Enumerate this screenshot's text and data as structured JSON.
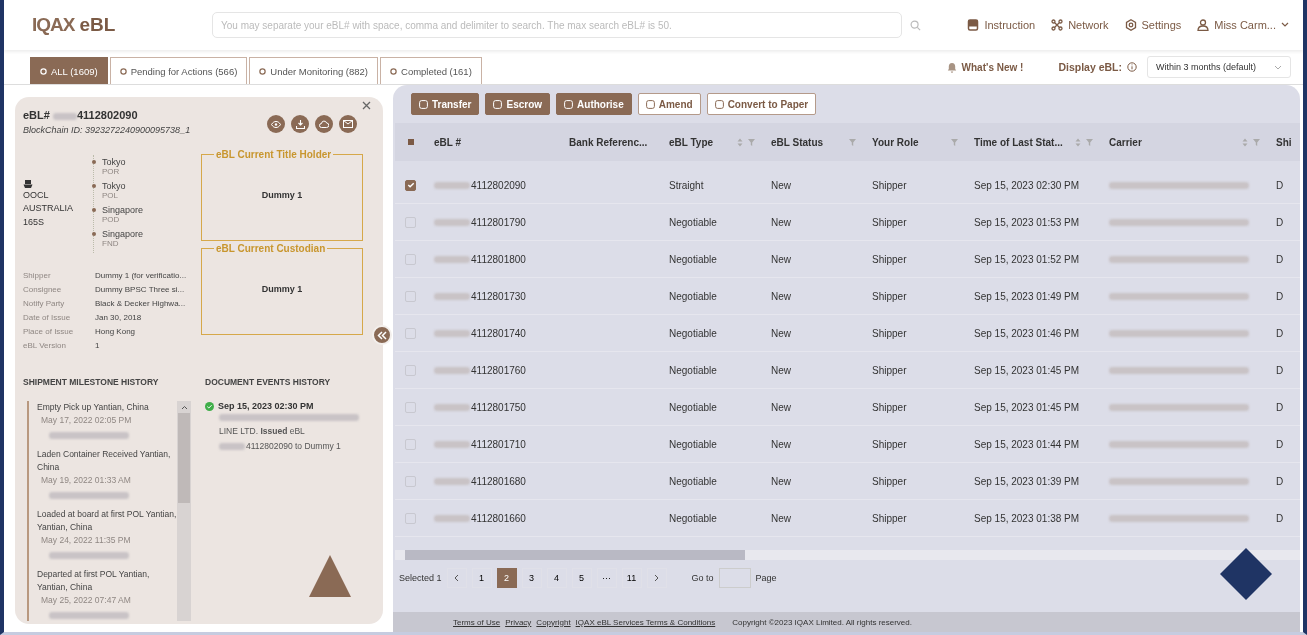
{
  "header": {
    "logo": "IQAX",
    "product": "eBL",
    "search": {
      "placeholder": "You may separate your eBL# with space, comma and delimiter to search. The max search eBL# is 50."
    },
    "nav": [
      {
        "kind": "book",
        "label": "Instruction"
      },
      {
        "kind": "network",
        "label": "Network"
      },
      {
        "kind": "gear",
        "label": "Settings"
      },
      {
        "kind": "user",
        "label": "Miss Carm..."
      }
    ]
  },
  "tabs": [
    {
      "label": "ALL (1609)",
      "selected": true
    },
    {
      "label": "Pending for Actions (566)",
      "selected": false
    },
    {
      "label": "Under Monitoring (882)",
      "selected": false
    },
    {
      "label": "Completed (161)",
      "selected": false
    }
  ],
  "whats_new": "What's New !",
  "display": {
    "label": "Display eBL:",
    "value": "Within 3 months (default)"
  },
  "detail": {
    "ebl_prefix": "eBL#",
    "ebl_no": "4112802090",
    "blockchain_id": "BlockChain ID: 3923272240900095738_1",
    "vessel": "OOCL AUSTRALIA 165S",
    "route": [
      {
        "place": "Tokyo",
        "code": "POR"
      },
      {
        "place": "Tokyo",
        "code": "POL"
      },
      {
        "place": "Singapore",
        "code": "POD"
      },
      {
        "place": "Singapore",
        "code": "FND"
      }
    ],
    "title_holder": {
      "legend": "eBL Current Title Holder",
      "value": "Dummy 1"
    },
    "custodian": {
      "legend": "eBL Current Custodian",
      "value": "Dummy 1"
    },
    "fields": [
      {
        "label": "Shipper",
        "value": "Dummy 1 (for verificatio..."
      },
      {
        "label": "Consignee",
        "value": "Dummy BPSC Three si..."
      },
      {
        "label": "Notify Party",
        "value": "Black & Decker Highwa..."
      },
      {
        "label": "Date of Issue",
        "value": "Jan 30, 2018"
      },
      {
        "label": "Place of Issue",
        "value": "Hong Kong"
      },
      {
        "label": "eBL Version",
        "value": "1"
      }
    ],
    "milestone_heading": "SHIPMENT MILESTONE HISTORY",
    "milestones": [
      {
        "event": "Empty Pick up Yantian, China",
        "date": "May 17, 2022 02:05 PM"
      },
      {
        "event": "Laden Container Received Yantian, China",
        "date": "May 19, 2022 01:33 AM"
      },
      {
        "event": "Loaded at board at first POL Yantian, Yantian, China",
        "date": "May 24, 2022 11:35 PM"
      },
      {
        "event": "Departed at first POL Yantian, Yantian, China",
        "date": "May 25, 2022 07:47 AM"
      }
    ],
    "events_heading": "DOCUMENT EVENTS HISTORY",
    "events": [
      {
        "time": "Sep 15, 2023 02:30 PM",
        "done": true,
        "text": "LINE LTD. **Issued** eBL",
        "target": "4112802090 to Dummy 1"
      }
    ]
  },
  "toolbar": [
    {
      "label": "Transfer",
      "kind": "primary"
    },
    {
      "label": "Escrow",
      "kind": "primary"
    },
    {
      "label": "Authorise",
      "kind": "primary"
    },
    {
      "label": "Amend",
      "kind": "outline"
    },
    {
      "label": "Convert to Paper",
      "kind": "outline"
    }
  ],
  "table": {
    "select_all_indeterminate": true,
    "columns": [
      {
        "label": "eBL #",
        "sort": false,
        "filter": false
      },
      {
        "label": "Bank Referenc...",
        "sort": false,
        "filter": false
      },
      {
        "label": "eBL Type",
        "sort": true,
        "filter": true
      },
      {
        "label": "eBL Status",
        "sort": false,
        "filter": true
      },
      {
        "label": "Your Role",
        "sort": false,
        "filter": true
      },
      {
        "label": "Time of Last Stat...",
        "sort": true,
        "filter": true
      },
      {
        "label": "Carrier",
        "sort": true,
        "filter": true
      },
      {
        "label": "Shi"
      }
    ],
    "rows": [
      {
        "selected": true,
        "ebl": "4112802090",
        "type": "Straight",
        "status": "New",
        "role": "Shipper",
        "time": "Sep 15, 2023 02:30 PM",
        "ship": "D"
      },
      {
        "selected": false,
        "ebl": "4112801790",
        "type": "Negotiable",
        "status": "New",
        "role": "Shipper",
        "time": "Sep 15, 2023 01:53 PM",
        "ship": "D"
      },
      {
        "selected": false,
        "ebl": "4112801800",
        "type": "Negotiable",
        "status": "New",
        "role": "Shipper",
        "time": "Sep 15, 2023 01:52 PM",
        "ship": "D"
      },
      {
        "selected": false,
        "ebl": "4112801730",
        "type": "Negotiable",
        "status": "New",
        "role": "Shipper",
        "time": "Sep 15, 2023 01:49 PM",
        "ship": "D"
      },
      {
        "selected": false,
        "ebl": "4112801740",
        "type": "Negotiable",
        "status": "New",
        "role": "Shipper",
        "time": "Sep 15, 2023 01:46 PM",
        "ship": "D"
      },
      {
        "selected": false,
        "ebl": "4112801760",
        "type": "Negotiable",
        "status": "New",
        "role": "Shipper",
        "time": "Sep 15, 2023 01:45 PM",
        "ship": "D"
      },
      {
        "selected": false,
        "ebl": "4112801750",
        "type": "Negotiable",
        "status": "New",
        "role": "Shipper",
        "time": "Sep 15, 2023 01:45 PM",
        "ship": "D"
      },
      {
        "selected": false,
        "ebl": "4112801710",
        "type": "Negotiable",
        "status": "New",
        "role": "Shipper",
        "time": "Sep 15, 2023 01:44 PM",
        "ship": "D"
      },
      {
        "selected": false,
        "ebl": "4112801680",
        "type": "Negotiable",
        "status": "New",
        "role": "Shipper",
        "time": "Sep 15, 2023 01:39 PM",
        "ship": "D"
      },
      {
        "selected": false,
        "ebl": "4112801660",
        "type": "Negotiable",
        "status": "New",
        "role": "Shipper",
        "time": "Sep 15, 2023 01:38 PM",
        "ship": "D"
      }
    ]
  },
  "pagination": {
    "selected_label": "Selected 1",
    "pages": [
      {
        "label": "1",
        "selected": false
      },
      {
        "label": "2",
        "selected": true
      },
      {
        "label": "3",
        "selected": false
      },
      {
        "label": "4",
        "selected": false
      },
      {
        "label": "5",
        "selected": false
      },
      {
        "label": "···",
        "selected": false
      },
      {
        "label": "11",
        "selected": false
      }
    ],
    "goto": "Go to",
    "page": "Page"
  },
  "footer": {
    "links": [
      "Terms of Use",
      "Privacy",
      "Copyright",
      "IQAX eBL Services Terms & Conditions"
    ],
    "copyright": "Copyright ©2023 IQAX Limited. All rights reserved."
  }
}
